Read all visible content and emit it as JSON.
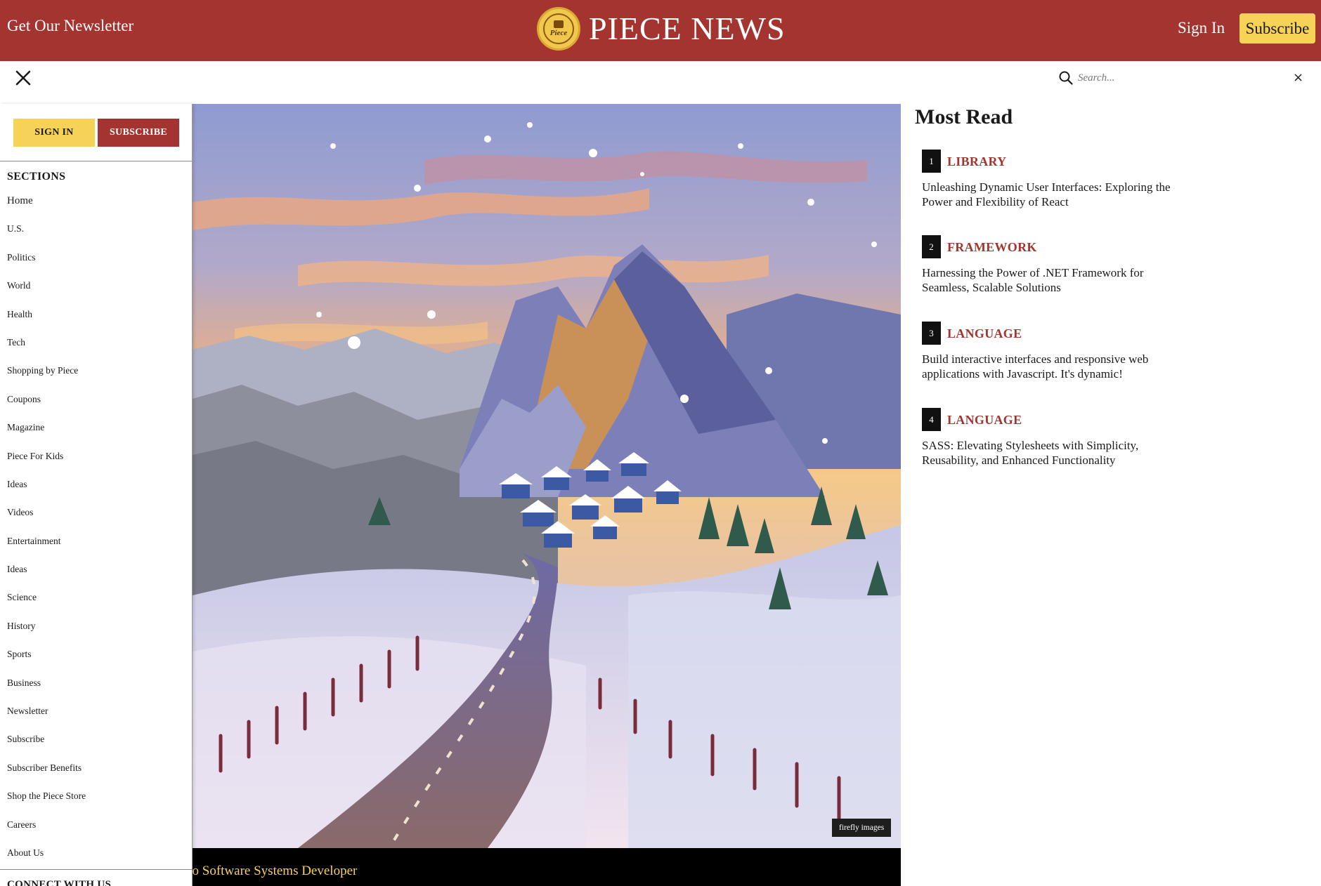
{
  "header": {
    "newsletter_link": "Get Our Newsletter",
    "brand_name": "PIECE NEWS",
    "logo_word": "Piece",
    "sign_in": "Sign In",
    "subscribe": "Subscribe"
  },
  "search": {
    "placeholder": "Search...",
    "clear_label": "×"
  },
  "side_menu": {
    "sign_in": "SIGN IN",
    "subscribe": "SUBSCRIBE",
    "sections_title": "SECTIONS",
    "sections": [
      "Home",
      "U.S.",
      "Politics",
      "World",
      "Health",
      "Tech",
      "Shopping by Piece",
      "Coupons",
      "Magazine",
      "Piece For Kids",
      "Ideas",
      "Videos",
      "Entertainment",
      "Ideas",
      "Science",
      "History",
      "Sports",
      "Business",
      "Newsletter",
      "Subscribe",
      "Subscriber Benefits",
      "Shop the Piece Store",
      "Careers",
      "About Us"
    ],
    "connect_title": "CONNECT WITH US"
  },
  "hero": {
    "image_credit": "firefly images",
    "caption": "d to Software Systems Developer"
  },
  "most_read": {
    "title": "Most Read",
    "items": [
      {
        "rank": "1",
        "category": "LIBRARY",
        "headline": "Unleashing Dynamic User Interfaces: Exploring the Power and Flexibility of React"
      },
      {
        "rank": "2",
        "category": "FRAMEWORK",
        "headline": "Harnessing the Power of .NET Framework for Seamless, Scalable Solutions"
      },
      {
        "rank": "3",
        "category": "LANGUAGE",
        "headline": "Build interactive interfaces and responsive web applications with Javascript. It's dynamic!"
      },
      {
        "rank": "4",
        "category": "LANGUAGE",
        "headline": "SASS: Elevating Stylesheets with Simplicity, Reusability, and Enhanced Functionality"
      }
    ]
  },
  "colors": {
    "brand_red": "#a33430",
    "accent_yellow": "#f6d257",
    "text_dark": "#1a1a1a"
  },
  "icons": [
    "close-icon",
    "search-icon",
    "logo-icon"
  ]
}
